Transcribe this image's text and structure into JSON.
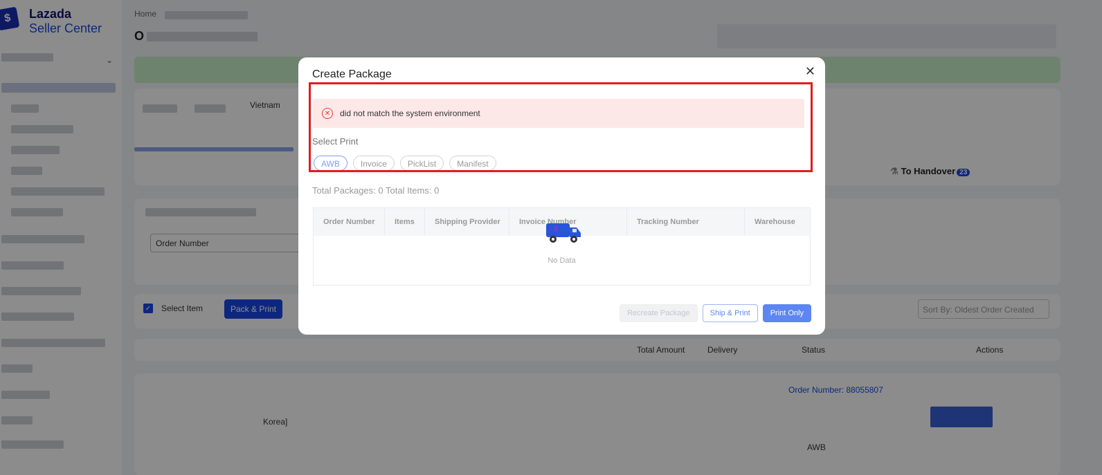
{
  "brand": {
    "name_line1": "Lazada",
    "name_line2": "Seller Center",
    "mark": "$"
  },
  "breadcrumb": "Home",
  "page_title": "O",
  "tabs_bg": {
    "country": "Vietnam",
    "to_handover": "To Handover",
    "to_handover_count": "23"
  },
  "filters": {
    "order_number_placeholder": "Order Number"
  },
  "toolbar": {
    "select_item": "Select Item",
    "pack_print": "Pack & Print",
    "sort_by": "Sort By: Oldest Order Created"
  },
  "list_columns": [
    "Total Amount",
    "Delivery",
    "Status",
    "Actions"
  ],
  "order": {
    "label": "Order Number:",
    "number": "88055807",
    "destination": "Korea]",
    "awb": "AWB"
  },
  "modal": {
    "title": "Create Package",
    "error": "did not match the system environment",
    "select_print": "Select Print",
    "print_tabs": [
      "AWB",
      "Invoice",
      "PickList",
      "Manifest"
    ],
    "totals": "Total Packages: 0   Total Items: 0",
    "columns": [
      "Order Number",
      "Items",
      "Shipping Provider",
      "Invoice Number",
      "Tracking Number",
      "Warehouse"
    ],
    "empty": "No Data",
    "buttons": {
      "recreate": "Recreate Package",
      "ship_print": "Ship & Print",
      "print_only": "Print Only"
    }
  },
  "colors": {
    "accent": "#1a48e6",
    "error": "#e53935",
    "highlight": "#e31b1b"
  }
}
